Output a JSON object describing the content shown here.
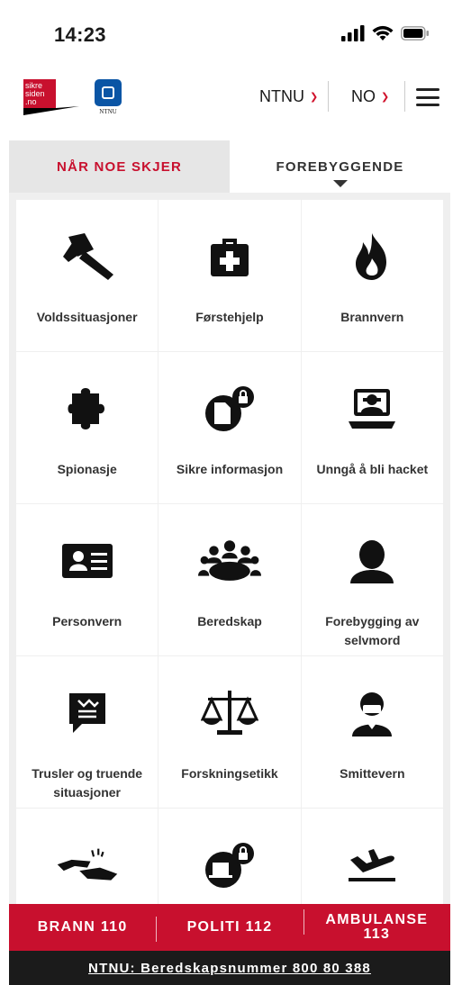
{
  "status": {
    "time": "14:23"
  },
  "header": {
    "logo_text": "sikre siden .no",
    "ntnu_logo_text": "NTNU",
    "org_select": "NTNU",
    "lang_select": "NO"
  },
  "tabs": [
    {
      "label": "NÅR NOE SKJER",
      "active": true
    },
    {
      "label": "FOREBYGGENDE",
      "active": false
    }
  ],
  "tiles": [
    {
      "label": "Voldssituasjoner",
      "icon": "hammer-icon"
    },
    {
      "label": "Førstehjelp",
      "icon": "first-aid-kit-icon"
    },
    {
      "label": "Brannvern",
      "icon": "fire-icon"
    },
    {
      "label": "Spionasje",
      "icon": "puzzle-piece-icon"
    },
    {
      "label": "Sikre informasjon",
      "icon": "secure-document-icon"
    },
    {
      "label": "Unngå å bli hacket",
      "icon": "hacker-computer-icon"
    },
    {
      "label": "Personvern",
      "icon": "id-card-icon"
    },
    {
      "label": "Beredskap",
      "icon": "group-meeting-icon"
    },
    {
      "label": "Forebygging av selvmord",
      "icon": "person-silhouette-icon"
    },
    {
      "label": "Trusler og truende situasjoner",
      "icon": "threat-speech-bubble-icon"
    },
    {
      "label": "Forskningsetikk",
      "icon": "scales-icon"
    },
    {
      "label": "Smittevern",
      "icon": "person-mask-icon"
    },
    {
      "label": "",
      "icon": "handshake-icon"
    },
    {
      "label": "",
      "icon": "secure-devices-icon"
    },
    {
      "label": "",
      "icon": "airplane-icon"
    }
  ],
  "emergency": {
    "fire": "BRANN 110",
    "police": "POLITI 112",
    "ambulance_line1": "AMBULANSE",
    "ambulance_line2": "113"
  },
  "footer": {
    "text": "NTNU: Beredskapsnummer 800 80 388"
  },
  "colors": {
    "accent": "#c8102e",
    "ntnu_blue": "#0a55a5",
    "footer_bg": "#1b1b1b"
  }
}
